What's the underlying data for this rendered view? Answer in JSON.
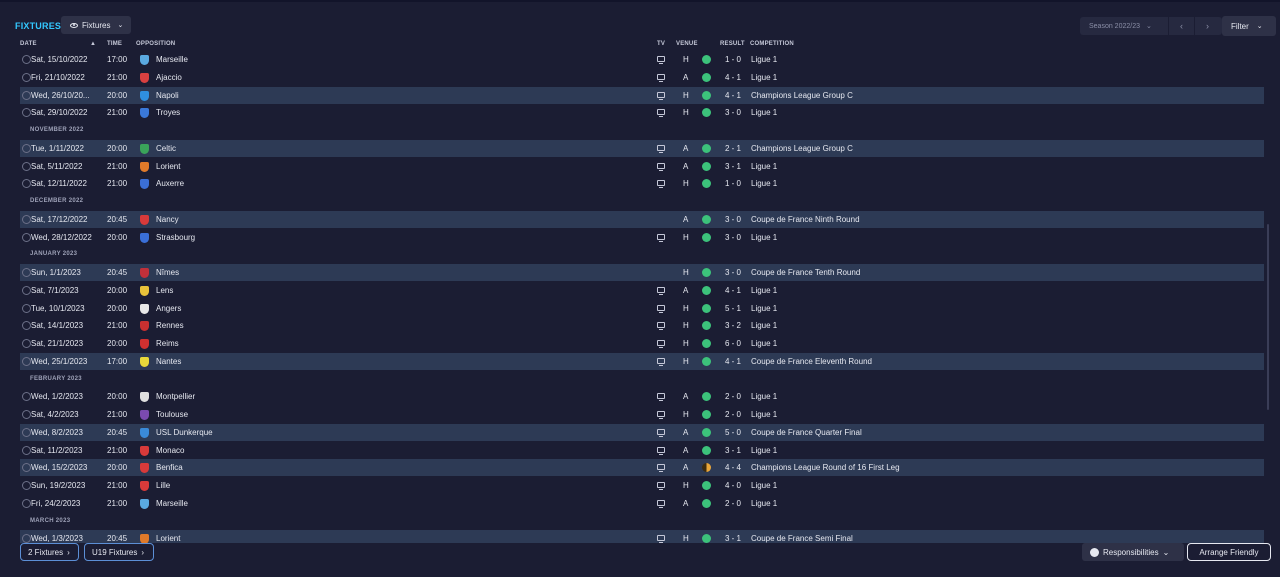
{
  "header": {
    "title": "FIXTURES",
    "view_label": "Fixtures",
    "season_label": "Season 2022/23",
    "filter_label": "Filter"
  },
  "columns": {
    "date": "DATE",
    "time": "TIME",
    "opposition": "OPPOSITION",
    "tv": "TV",
    "venue": "VENUE",
    "result": "RESULT",
    "competition": "COMPETITION"
  },
  "crest_colors": {
    "Marseille": "#5aa9e0",
    "Ajaccio": "#d94040",
    "Napoli": "#2f8fe0",
    "Troyes": "#3a78d8",
    "Celtic": "#3aa35a",
    "Lorient": "#e07a2a",
    "Auxerre": "#3b6fd6",
    "Nancy": "#d83a3a",
    "Strasbourg": "#3a6fd8",
    "Nîmes": "#c0303a",
    "Lens": "#e8c23a",
    "Angers": "#e8e8e8",
    "Rennes": "#c83030",
    "Reims": "#d03030",
    "Nantes": "#e8d83a",
    "Montpellier": "#e0e0e0",
    "Toulouse": "#7a4ab0",
    "USL Dunkerque": "#3a8ad8",
    "Monaco": "#d83a3a",
    "Benfica": "#d83a3a",
    "Lille": "#d83a3a"
  },
  "fixtures": [
    {
      "type": "row",
      "date": "Sat, 15/10/2022",
      "time": "17:00",
      "opp": "Marseille",
      "tv": true,
      "venue": "H",
      "outcome": "win",
      "result": "1 - 0",
      "comp": "Ligue 1",
      "hl": false
    },
    {
      "type": "row",
      "date": "Fri, 21/10/2022",
      "time": "21:00",
      "opp": "Ajaccio",
      "tv": true,
      "venue": "A",
      "outcome": "win",
      "result": "4 - 1",
      "comp": "Ligue 1",
      "hl": false
    },
    {
      "type": "row",
      "date": "Wed, 26/10/20...",
      "time": "20:00",
      "opp": "Napoli",
      "tv": true,
      "venue": "H",
      "outcome": "win",
      "result": "4 - 1",
      "comp": "Champions League Group C",
      "hl": true
    },
    {
      "type": "row",
      "date": "Sat, 29/10/2022",
      "time": "21:00",
      "opp": "Troyes",
      "tv": true,
      "venue": "H",
      "outcome": "win",
      "result": "3 - 0",
      "comp": "Ligue 1",
      "hl": false
    },
    {
      "type": "month",
      "label": "NOVEMBER 2022"
    },
    {
      "type": "row",
      "date": "Tue, 1/11/2022",
      "time": "20:00",
      "opp": "Celtic",
      "tv": true,
      "venue": "A",
      "outcome": "win",
      "result": "2 - 1",
      "comp": "Champions League Group C",
      "hl": true
    },
    {
      "type": "row",
      "date": "Sat, 5/11/2022",
      "time": "21:00",
      "opp": "Lorient",
      "tv": true,
      "venue": "A",
      "outcome": "win",
      "result": "3 - 1",
      "comp": "Ligue 1",
      "hl": false
    },
    {
      "type": "row",
      "date": "Sat, 12/11/2022",
      "time": "21:00",
      "opp": "Auxerre",
      "tv": true,
      "venue": "H",
      "outcome": "win",
      "result": "1 - 0",
      "comp": "Ligue 1",
      "hl": false
    },
    {
      "type": "month",
      "label": "DECEMBER 2022"
    },
    {
      "type": "row",
      "date": "Sat, 17/12/2022",
      "time": "20:45",
      "opp": "Nancy",
      "tv": false,
      "venue": "A",
      "outcome": "win",
      "result": "3 - 0",
      "comp": "Coupe de France Ninth Round",
      "hl": true
    },
    {
      "type": "row",
      "date": "Wed, 28/12/2022",
      "time": "20:00",
      "opp": "Strasbourg",
      "tv": true,
      "venue": "H",
      "outcome": "win",
      "result": "3 - 0",
      "comp": "Ligue 1",
      "hl": false
    },
    {
      "type": "month",
      "label": "JANUARY 2023"
    },
    {
      "type": "row",
      "date": "Sun, 1/1/2023",
      "time": "20:45",
      "opp": "Nîmes",
      "tv": false,
      "venue": "H",
      "outcome": "win",
      "result": "3 - 0",
      "comp": "Coupe de France Tenth Round",
      "hl": true
    },
    {
      "type": "row",
      "date": "Sat, 7/1/2023",
      "time": "20:00",
      "opp": "Lens",
      "tv": true,
      "venue": "A",
      "outcome": "win",
      "result": "4 - 1",
      "comp": "Ligue 1",
      "hl": false
    },
    {
      "type": "row",
      "date": "Tue, 10/1/2023",
      "time": "20:00",
      "opp": "Angers",
      "tv": true,
      "venue": "H",
      "outcome": "win",
      "result": "5 - 1",
      "comp": "Ligue 1",
      "hl": false
    },
    {
      "type": "row",
      "date": "Sat, 14/1/2023",
      "time": "21:00",
      "opp": "Rennes",
      "tv": true,
      "venue": "H",
      "outcome": "win",
      "result": "3 - 2",
      "comp": "Ligue 1",
      "hl": false
    },
    {
      "type": "row",
      "date": "Sat, 21/1/2023",
      "time": "20:00",
      "opp": "Reims",
      "tv": true,
      "venue": "H",
      "outcome": "win",
      "result": "6 - 0",
      "comp": "Ligue 1",
      "hl": false
    },
    {
      "type": "row",
      "date": "Wed, 25/1/2023",
      "time": "17:00",
      "opp": "Nantes",
      "tv": true,
      "venue": "H",
      "outcome": "win",
      "result": "4 - 1",
      "comp": "Coupe de France Eleventh Round",
      "hl": true
    },
    {
      "type": "month",
      "label": "FEBRUARY 2023"
    },
    {
      "type": "row",
      "date": "Wed, 1/2/2023",
      "time": "20:00",
      "opp": "Montpellier",
      "tv": true,
      "venue": "A",
      "outcome": "win",
      "result": "2 - 0",
      "comp": "Ligue 1",
      "hl": false
    },
    {
      "type": "row",
      "date": "Sat, 4/2/2023",
      "time": "21:00",
      "opp": "Toulouse",
      "tv": true,
      "venue": "H",
      "outcome": "win",
      "result": "2 - 0",
      "comp": "Ligue 1",
      "hl": false
    },
    {
      "type": "row",
      "date": "Wed, 8/2/2023",
      "time": "20:45",
      "opp": "USL Dunkerque",
      "tv": true,
      "venue": "A",
      "outcome": "win",
      "result": "5 - 0",
      "comp": "Coupe de France Quarter Final",
      "hl": true
    },
    {
      "type": "row",
      "date": "Sat, 11/2/2023",
      "time": "21:00",
      "opp": "Monaco",
      "tv": true,
      "venue": "A",
      "outcome": "win",
      "result": "3 - 1",
      "comp": "Ligue 1",
      "hl": false
    },
    {
      "type": "row",
      "date": "Wed, 15/2/2023",
      "time": "20:00",
      "opp": "Benfica",
      "tv": true,
      "venue": "A",
      "outcome": "draw",
      "result": "4 - 4",
      "comp": "Champions League Round of 16  First Leg",
      "hl": true
    },
    {
      "type": "row",
      "date": "Sun, 19/2/2023",
      "time": "21:00",
      "opp": "Lille",
      "tv": true,
      "venue": "H",
      "outcome": "win",
      "result": "4 - 0",
      "comp": "Ligue 1",
      "hl": false
    },
    {
      "type": "row",
      "date": "Fri, 24/2/2023",
      "time": "21:00",
      "opp": "Marseille",
      "tv": true,
      "venue": "A",
      "outcome": "win",
      "result": "2 - 0",
      "comp": "Ligue 1",
      "hl": false
    },
    {
      "type": "month",
      "label": "MARCH 2023"
    },
    {
      "type": "row",
      "date": "Wed, 1/3/2023",
      "time": "20:45",
      "opp": "Lorient",
      "tv": true,
      "venue": "H",
      "outcome": "win",
      "result": "3 - 1",
      "comp": "Coupe de France Semi Final",
      "hl": true
    }
  ],
  "footer": {
    "fixtures_btn": "2 Fixtures",
    "u19_btn": "U19 Fixtures",
    "responsibilities": "Responsibilities",
    "arrange_friendly": "Arrange Friendly"
  }
}
